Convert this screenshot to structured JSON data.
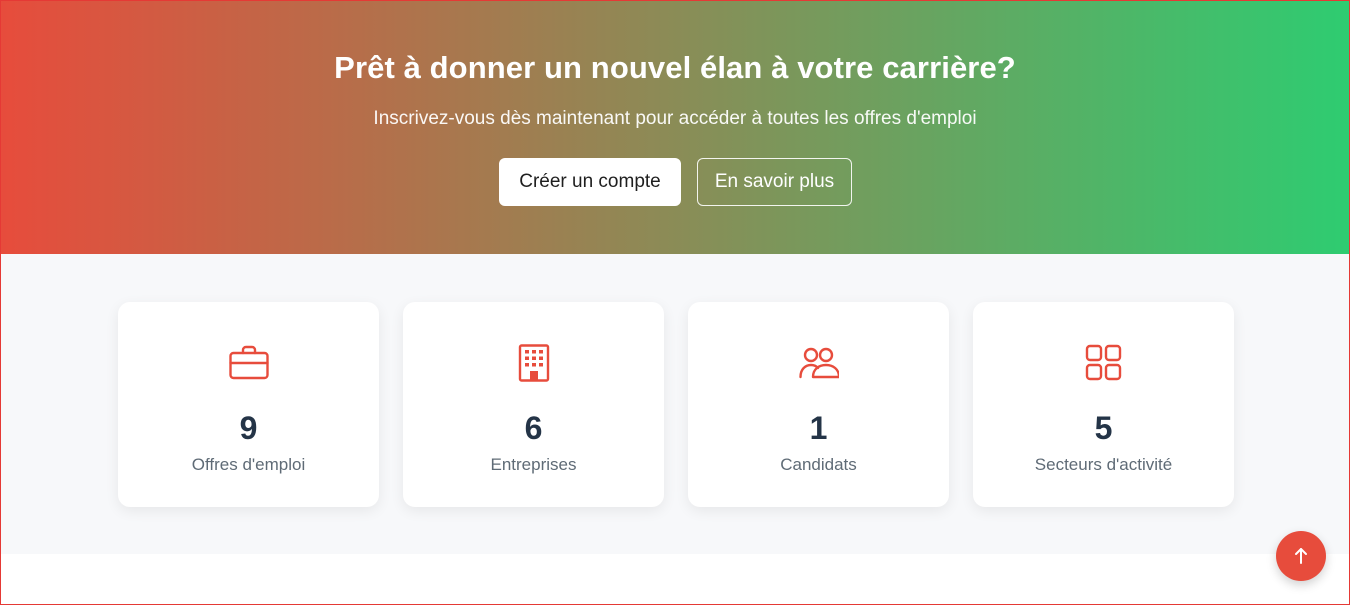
{
  "hero": {
    "title": "Prêt à donner un nouvel élan à votre carrière?",
    "subtitle": "Inscrivez-vous dès maintenant pour accéder à toutes les offres d'emploi",
    "primary_button": "Créer un compte",
    "secondary_button": "En savoir plus"
  },
  "stats": [
    {
      "icon": "briefcase-icon",
      "value": "9",
      "label": "Offres d'emploi"
    },
    {
      "icon": "building-icon",
      "value": "6",
      "label": "Entreprises"
    },
    {
      "icon": "users-icon",
      "value": "1",
      "label": "Candidats"
    },
    {
      "icon": "grid-icon",
      "value": "5",
      "label": "Secteurs d'activité"
    }
  ],
  "colors": {
    "gradient_start": "#e74c3c",
    "gradient_end": "#2ecc71",
    "accent": "#e74c3c",
    "stat_number": "#243447"
  },
  "scroll_top": {
    "icon": "arrow-up-icon"
  }
}
